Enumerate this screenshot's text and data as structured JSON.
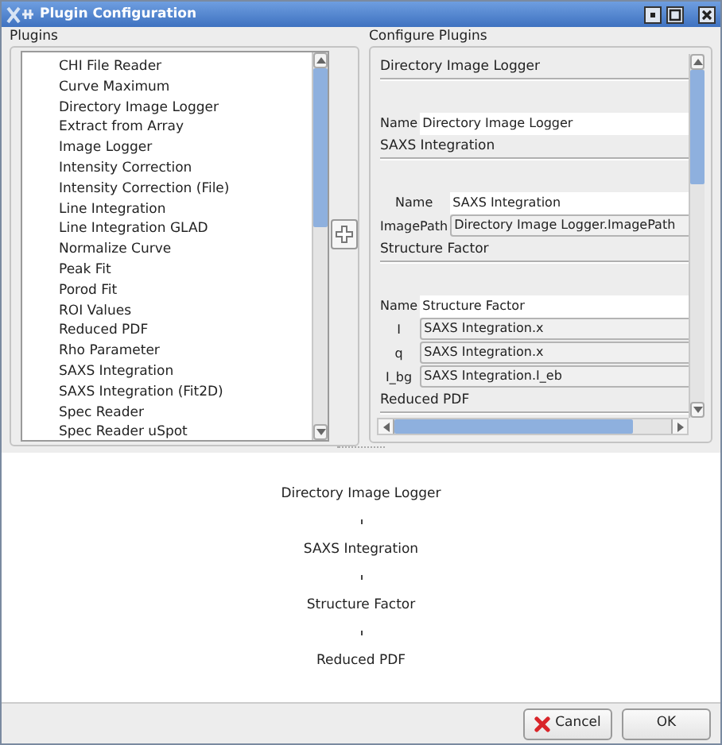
{
  "window": {
    "title": "Plugin Configuration"
  },
  "plugins": {
    "title": "Plugins",
    "items": [
      {
        "label": "CHI File Reader"
      },
      {
        "label": "Curve Maximum"
      },
      {
        "label": "Directory Image Logger"
      },
      {
        "label": "Extract from Array"
      },
      {
        "label": "Image Logger"
      },
      {
        "label": "Intensity Correction"
      },
      {
        "label": "Intensity Correction (File)"
      },
      {
        "label": "Line Integration"
      },
      {
        "label": "Line Integration GLAD"
      },
      {
        "label": "Normalize Curve"
      },
      {
        "label": "Peak Fit"
      },
      {
        "label": "Porod Fit"
      },
      {
        "label": "ROI Values"
      },
      {
        "label": "Reduced PDF"
      },
      {
        "label": "Rho Parameter"
      },
      {
        "label": "SAXS Integration"
      },
      {
        "label": "SAXS Integration (Fit2D)"
      },
      {
        "label": "Spec Reader"
      },
      {
        "label": "Spec Reader uSpot"
      }
    ]
  },
  "configure": {
    "title": "Configure Plugins",
    "sections": [
      {
        "title": "Directory Image Logger",
        "fields": [
          {
            "label": "Name",
            "kind": "text",
            "value": "Directory Image Logger"
          }
        ]
      },
      {
        "title": "SAXS Integration",
        "fields": [
          {
            "label": "Name",
            "kind": "text",
            "value": "SAXS Integration"
          },
          {
            "label": "ImagePath",
            "kind": "combo",
            "value": "Directory Image Logger.ImagePath"
          }
        ]
      },
      {
        "title": "Structure Factor",
        "fields": [
          {
            "label": "Name",
            "kind": "text",
            "value": "Structure Factor"
          },
          {
            "label": "I",
            "kind": "combo",
            "value": "SAXS Integration.x"
          },
          {
            "label": "q",
            "kind": "combo",
            "value": "SAXS Integration.x"
          },
          {
            "label": "I_bg",
            "kind": "combo",
            "value": "SAXS Integration.I_eb"
          }
        ]
      },
      {
        "title": "Reduced PDF"
      }
    ]
  },
  "pipeline": {
    "nodes": [
      "Directory Image Logger",
      "SAXS Integration",
      "Structure Factor",
      "Reduced PDF"
    ]
  },
  "buttons": [
    {
      "label": "Cancel",
      "kind": "cancel"
    },
    {
      "label": "OK",
      "kind": "ok"
    }
  ]
}
